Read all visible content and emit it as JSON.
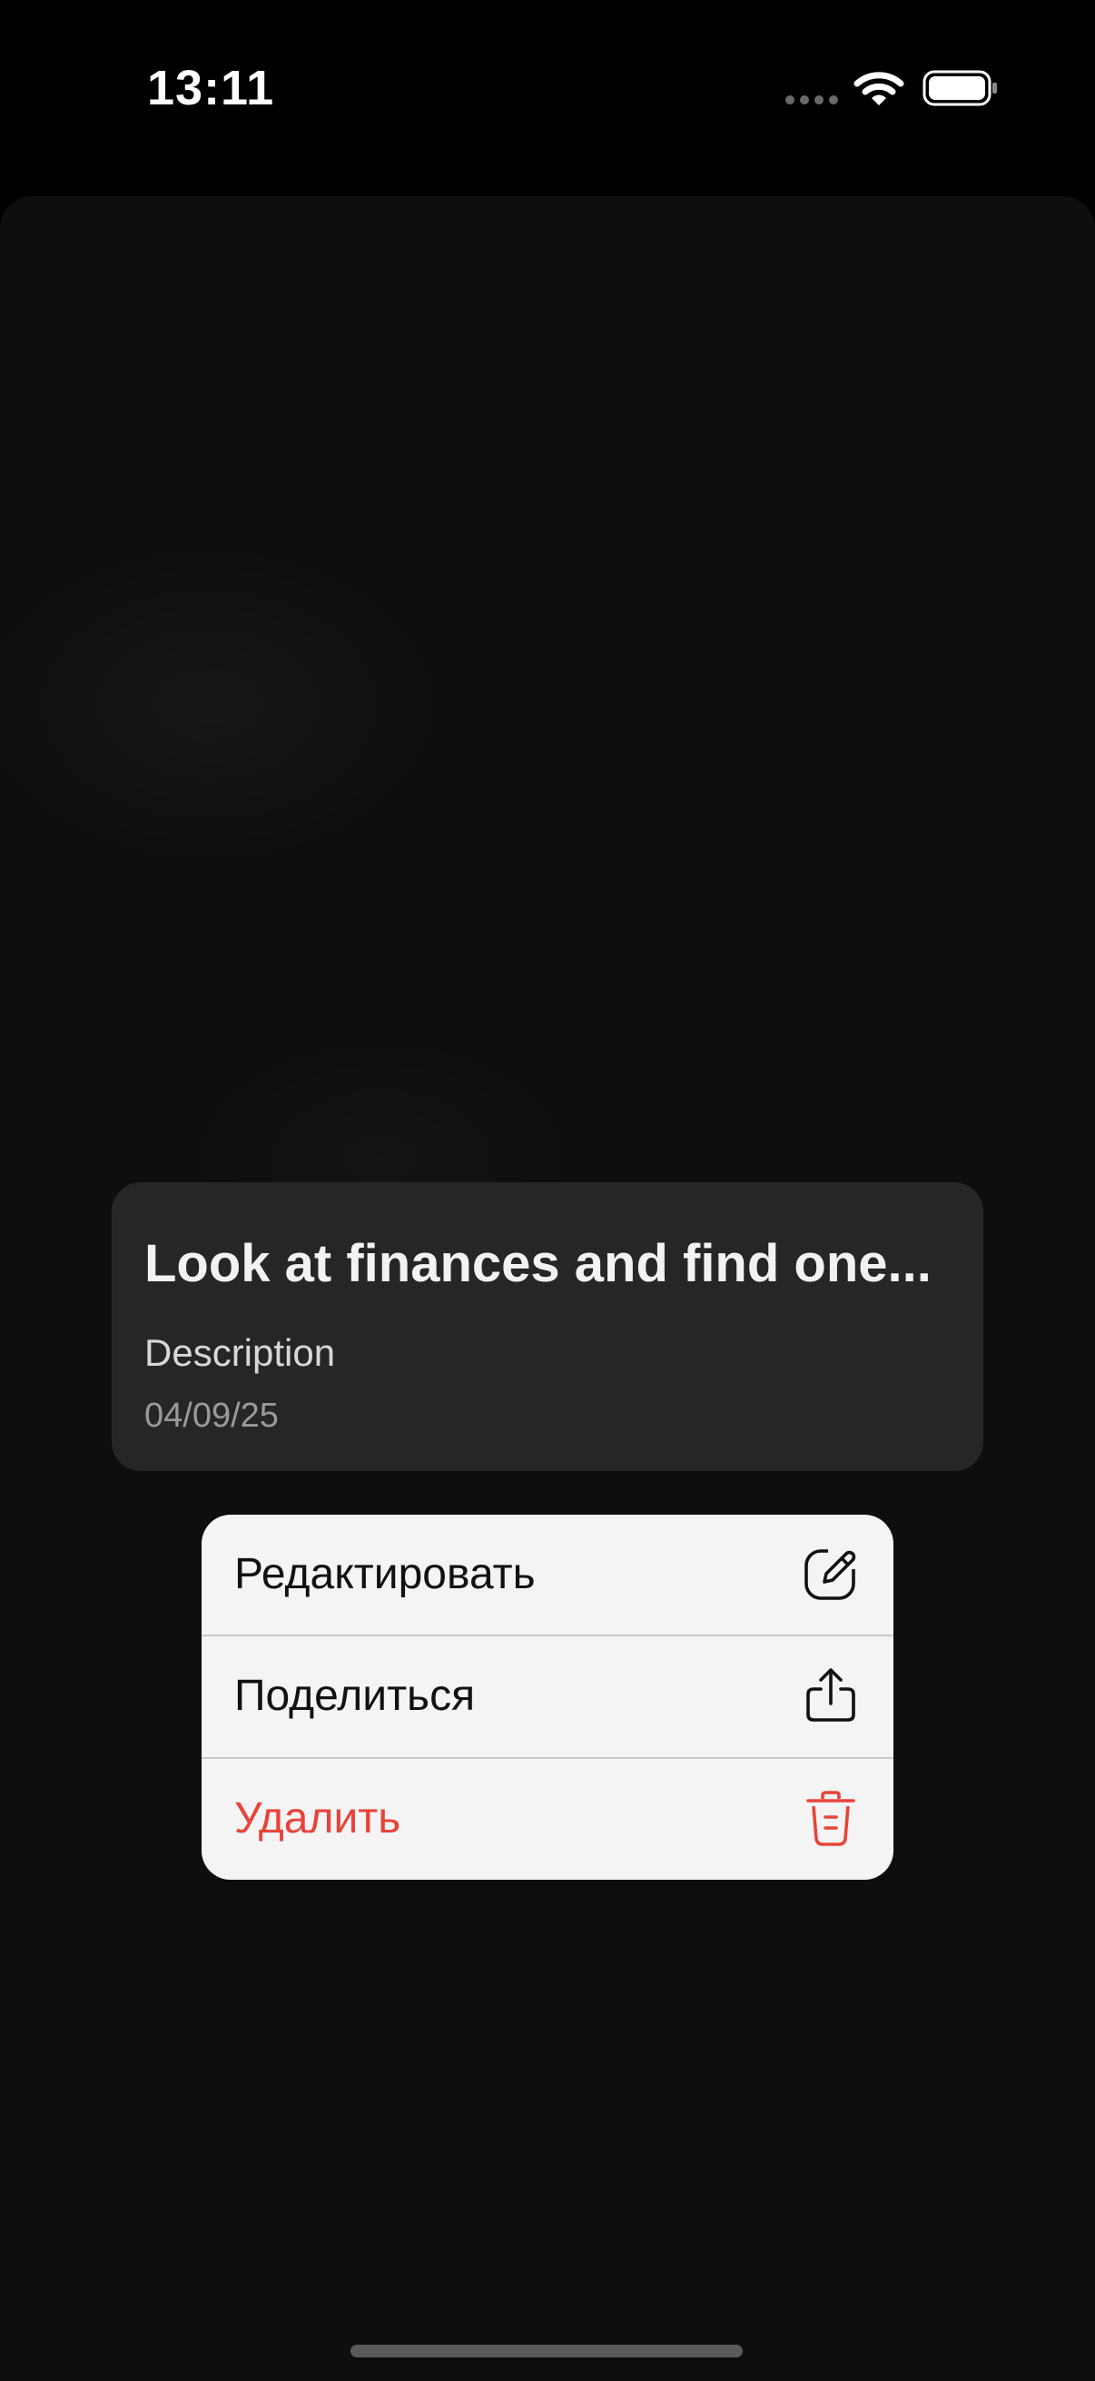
{
  "status_bar": {
    "time": "13:11",
    "icons": [
      "signal-dots-icon",
      "wifi-icon",
      "battery-icon"
    ]
  },
  "note": {
    "title": "Look at finances and find one...",
    "description": "Description",
    "date": "04/09/25"
  },
  "context_menu": {
    "items": [
      {
        "label": "Редактировать",
        "icon": "edit-icon"
      },
      {
        "label": "Поделиться",
        "icon": "share-icon"
      },
      {
        "label": "Удалить",
        "icon": "trash-icon",
        "destructive": true
      }
    ]
  },
  "colors": {
    "background": "#000000",
    "card": "#262628",
    "menu": "#f4f4f4",
    "destructive": "#e8443a"
  }
}
